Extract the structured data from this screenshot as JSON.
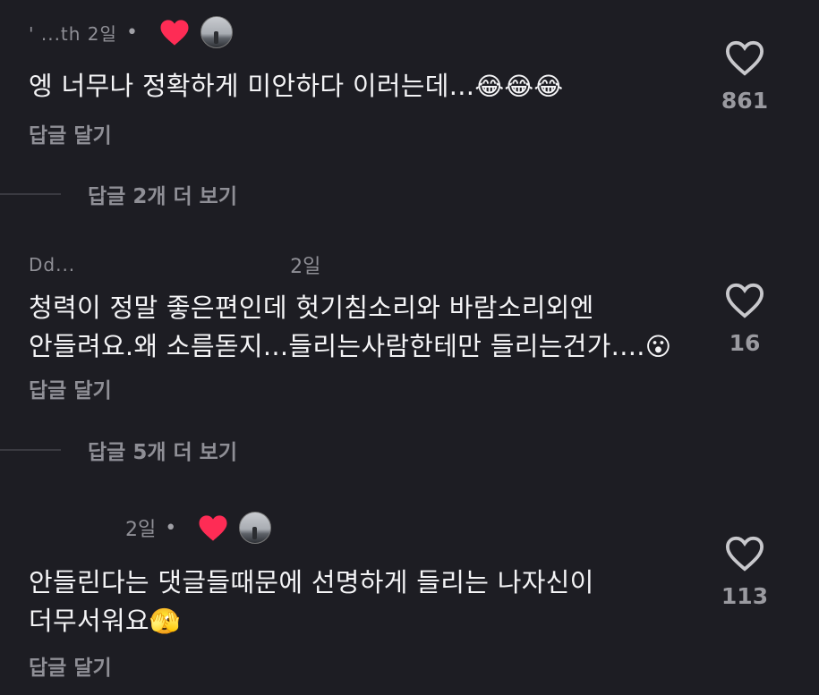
{
  "comments": [
    {
      "author": "' ...th 2일",
      "time": "",
      "text": "엥 너무나 정확하게 미안하다 이러는데...",
      "emoji": "😂😂😂",
      "reply_label": "답글 달기",
      "likes": "861",
      "more_replies": "답글 2개 더 보기",
      "creator_liked": true
    },
    {
      "author": "Dd...",
      "time": "2일",
      "text_line1": "청력이 정말 좋은편인데 헛기침소리와 바람소리외엔",
      "text_line2": "안들려요.왜 소름돋지...들리는사람한테만 들리는건가....",
      "emoji": "😮",
      "reply_label": "답글 달기",
      "likes": "16",
      "more_replies": "답글 5개 더 보기",
      "creator_liked": false
    },
    {
      "author": "",
      "time": "2일",
      "text_line1": "안들린다는 댓글들때문에 선명하게 들리는 나자신이",
      "text_line2": "더무서워요",
      "emoji": "🫣",
      "reply_label": "답글 달기",
      "likes": "113",
      "creator_liked": true
    }
  ],
  "colors": {
    "background": "#1d1d23",
    "heart_red": "#fe2c55",
    "muted": "#8f8f96"
  },
  "icons": {
    "like": "heart-outline-icon",
    "creator_like": "heart-filled-icon"
  }
}
